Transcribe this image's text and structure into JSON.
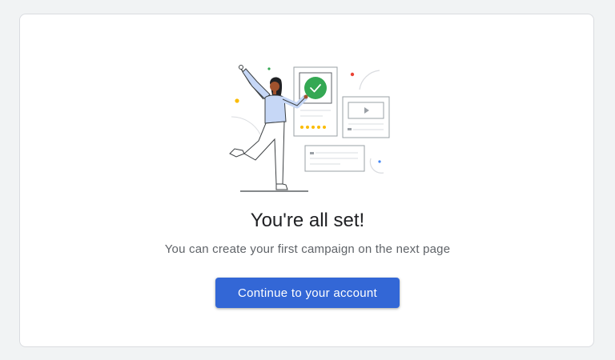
{
  "card": {
    "title": "You're all set!",
    "subtitle": "You can create your first campaign on the next page",
    "continue_label": "Continue to your account"
  },
  "colors": {
    "background": "#f1f3f4",
    "card": "#ffffff",
    "primary_button": "#3367d6",
    "title_text": "#202124",
    "subtitle_text": "#5f6368",
    "check_green": "#34a853",
    "dot_yellow": "#fbbc04",
    "dot_red": "#ea4335",
    "dot_blue": "#4285f4",
    "shirt": "#c6d7f6"
  },
  "icons": {
    "illustration": "celebration-illustration",
    "check": "check-icon",
    "play": "play-icon"
  }
}
